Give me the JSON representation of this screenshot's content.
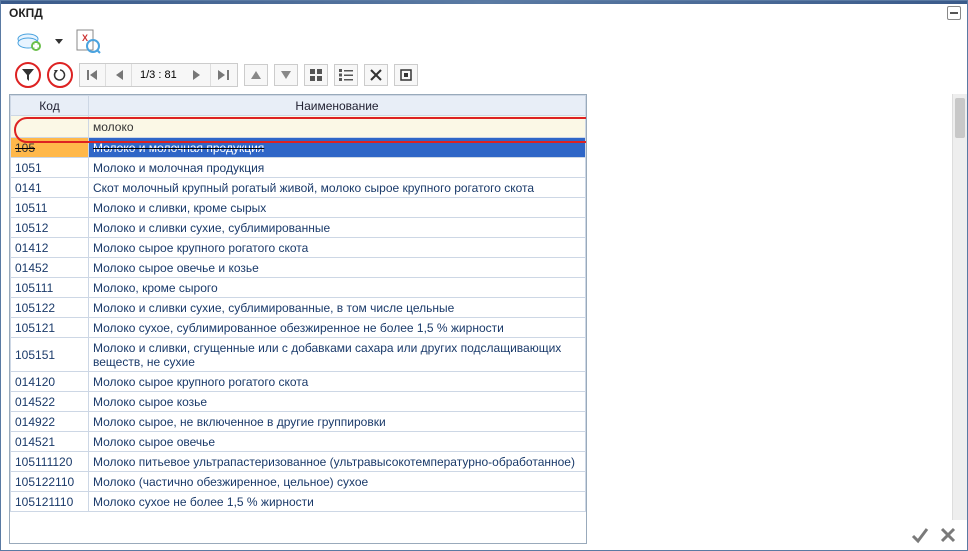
{
  "title": "ОКПД",
  "nav": {
    "pager_label": "1/3 : 81"
  },
  "columns": {
    "code": "Код",
    "name": "Наименование"
  },
  "filter": {
    "code_value": "",
    "name_value": "молоко"
  },
  "rows": [
    {
      "code": "105",
      "name": "Молоко и молочная продукция",
      "selected": true
    },
    {
      "code": "1051",
      "name": "Молоко и молочная продукция"
    },
    {
      "code": "0141",
      "name": "Скот молочный крупный рогатый живой, молоко сырое крупного рогатого скота"
    },
    {
      "code": "10511",
      "name": "Молоко и сливки, кроме сырых"
    },
    {
      "code": "10512",
      "name": "Молоко и сливки сухие, сублимированные"
    },
    {
      "code": "01412",
      "name": "Молоко сырое крупного рогатого скота"
    },
    {
      "code": "01452",
      "name": "Молоко сырое овечье и козье"
    },
    {
      "code": "105111",
      "name": "Молоко, кроме сырого"
    },
    {
      "code": "105122",
      "name": "Молоко и сливки сухие, сублимированные, в том числе цельные"
    },
    {
      "code": "105121",
      "name": "Молоко сухое, сублимированное обезжиренное не более 1,5 % жирности"
    },
    {
      "code": "105151",
      "name": "Молоко и сливки, сгущенные или с добавками сахара или других подслащивающих веществ, не сухие",
      "wrap": true
    },
    {
      "code": "014120",
      "name": "Молоко сырое крупного рогатого скота"
    },
    {
      "code": "014522",
      "name": "Молоко сырое козье"
    },
    {
      "code": "014922",
      "name": "Молоко сырое, не включенное в другие группировки"
    },
    {
      "code": "014521",
      "name": "Молоко сырое овечье"
    },
    {
      "code": "105111120",
      "name": "Молоко питьевое ультрапастеризованное (ультравысокотемпературно-обработанное)"
    },
    {
      "code": "105122110",
      "name": "Молоко (частично обезжиренное, цельное) сухое"
    },
    {
      "code": "105121110",
      "name": "Молоко сухое не более 1,5 % жирности"
    }
  ]
}
